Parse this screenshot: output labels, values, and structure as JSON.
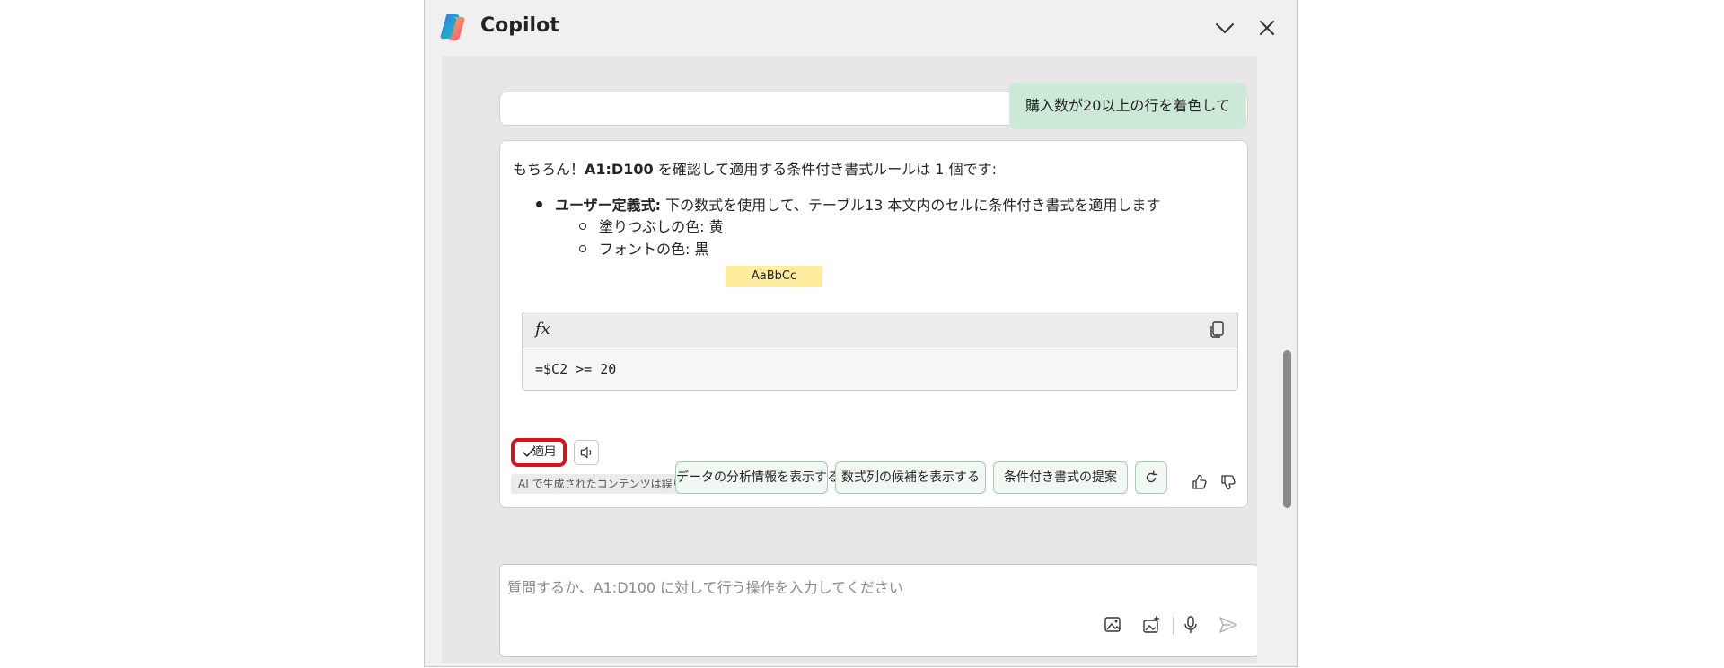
{
  "app": {
    "title": "Copilot"
  },
  "conversation": {
    "user_message": "購入数が20以上の行を着色して",
    "response": {
      "intro_prefix": "もちろん！",
      "intro_range": "A1:D100",
      "intro_suffix": " を確認して適用する条件付き書式ルールは 1 個です:",
      "rule_label": "ユーザー定義式:",
      "rule_text": " 下の数式を使用して、テーブル13 本文内のセルに条件付き書式を適用します",
      "fill_color": "塗りつぶしの色: 黄",
      "font_color": "フォントの色: 黒",
      "sample_text": "AaBbCc",
      "sample_bg": "#ffeb9c",
      "formula_icon": "fx",
      "formula": "=$C2 >= 20",
      "apply_label": "適用",
      "disclaimer": "AI で生成されたコンテンツは誤りを含む可能性があります。"
    }
  },
  "suggestions": [
    {
      "label": "データの分析情報を表示する"
    },
    {
      "label": "数式列の候補を表示する"
    },
    {
      "label": "条件付き書式の提案"
    }
  ],
  "composer": {
    "placeholder": "質問するか、A1:D100 に対して行う操作を入力してください"
  },
  "colors": {
    "highlight_border": "#e0101a",
    "user_bubble": "#cbe9d6",
    "chip_border": "#a9c9b4"
  }
}
